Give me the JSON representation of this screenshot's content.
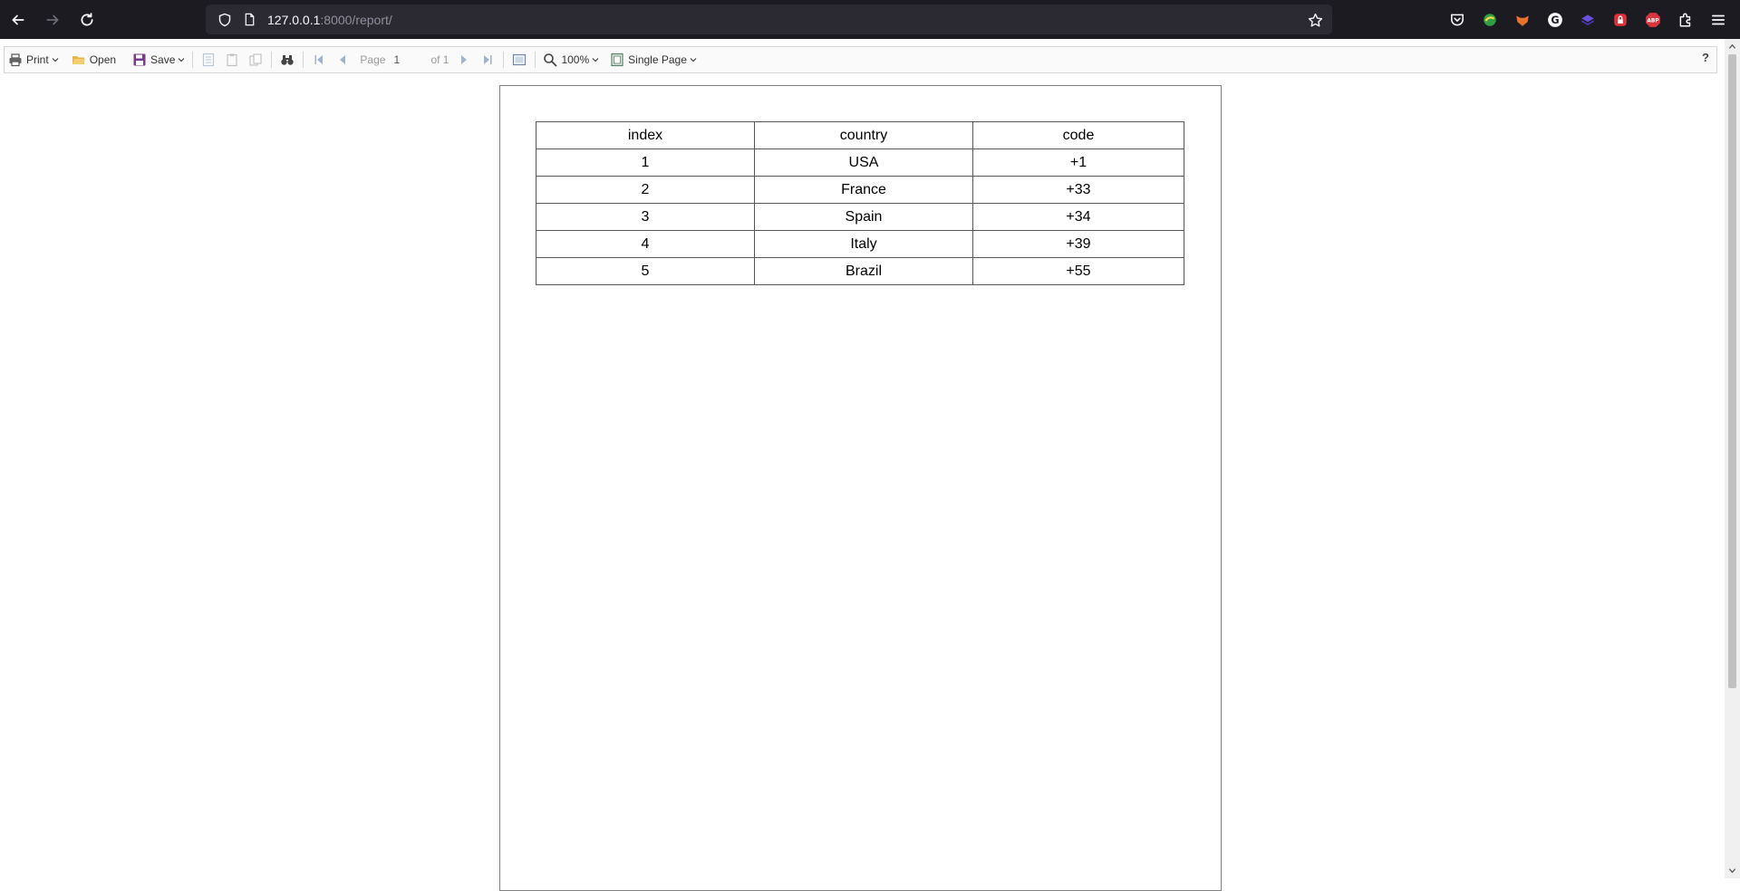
{
  "browser": {
    "url_host": "127.0.0.1",
    "url_rest": ":8000/report/"
  },
  "toolbar": {
    "print_label": "Print",
    "open_label": "Open",
    "save_label": "Save",
    "page_label": "Page",
    "page_value": "1",
    "of_label": "of 1",
    "zoom_label": "100%",
    "view_mode_label": "Single Page",
    "help_label": "?"
  },
  "report": {
    "columns": [
      "index",
      "country",
      "code"
    ],
    "rows": [
      [
        "1",
        "USA",
        "+1"
      ],
      [
        "2",
        "France",
        "+33"
      ],
      [
        "3",
        "Spain",
        "+34"
      ],
      [
        "4",
        "Italy",
        "+39"
      ],
      [
        "5",
        "Brazil",
        "+55"
      ]
    ]
  },
  "colors": {
    "chrome_bg": "#1c1b22",
    "urlbar_bg": "#2b2a33",
    "toolbar_bg": "#fafafa"
  }
}
